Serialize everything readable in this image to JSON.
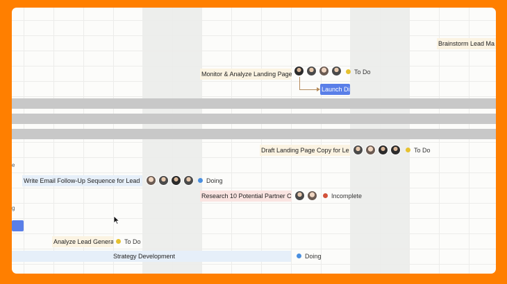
{
  "colors": {
    "todo": "#e6c12f",
    "doing": "#4a8fe0",
    "incomplete": "#d2523a",
    "accent_blue": "#5a7fe8",
    "frame_border": "#ff7f00"
  },
  "tasks": [
    {
      "name": "Brainstorm Lead Ma"
    },
    {
      "name": "Monitor & Analyze Landing Page",
      "status": "To Do"
    },
    {
      "name": "Launch Di"
    },
    {
      "name": "Draft Landing Page Copy for Le",
      "status": "To Do"
    },
    {
      "name": "Write Email Follow-Up Sequence for Lead",
      "status": "Doing"
    },
    {
      "name": "Research 10 Potential Partner Co",
      "status": "Incomplete"
    },
    {
      "name": "Analyze Lead Genera",
      "status": "To Do"
    },
    {
      "name": "Strategy Development",
      "status": "Doing"
    }
  ],
  "edge_fragments": {
    "row_a": "e",
    "row_b": "g"
  },
  "icons": [
    "avatar",
    "mouse-pointer-icon",
    "dependency-arrow-icon"
  ]
}
